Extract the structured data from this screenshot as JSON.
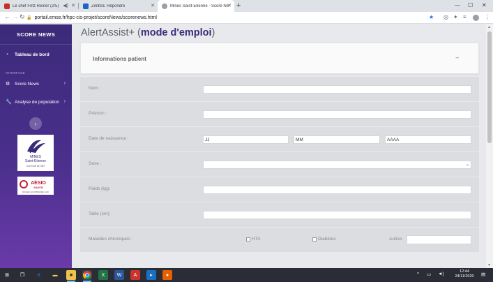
{
  "browser": {
    "tabs": [
      {
        "title": "Le chef Fritz Reiner (2/5)",
        "favicon_color": "#c4302b",
        "audio": true,
        "active": false
      },
      {
        "title": "Zimbra: Répondre",
        "favicon_color": "#1e64c8",
        "audio": false,
        "active": false
      },
      {
        "title": "Mines Saint-Etienne - Score News",
        "favicon_color": "#9aa0a6",
        "audio": false,
        "active": true
      }
    ],
    "new_tab_icon": "+",
    "url": "portail.emse.fr/hpc-cis-projet/scoreNews/scorenews.html",
    "window_controls": [
      "minimize-icon",
      "maximize-icon",
      "close-icon"
    ]
  },
  "sidebar": {
    "brand": "SCORE NEWS",
    "dashboard": "Tableau de bord",
    "section_label": "INTERFACE",
    "items": [
      {
        "label": "Score News",
        "icon": "gear-icon"
      },
      {
        "label": "Analyse de population",
        "icon": "wrench-icon"
      }
    ],
    "logos": {
      "mines": {
        "line1": "MINES",
        "line2": "Saint-Etienne",
        "tagline": "Une école de l'IMT"
      },
      "aesio": {
        "name": "AÉSIO",
        "sub": "SANTÉ",
        "tagline": "BOUGER, ACCOMPAGNER, AGIR"
      }
    }
  },
  "main": {
    "title_prefix": "AlertAssist+ (",
    "title_link": "mode d'emploi",
    "title_suffix": ")",
    "card_title": "Informations patient",
    "card_toggle": "–",
    "fields": {
      "nom": {
        "label": "Nom :",
        "value": ""
      },
      "prenom": {
        "label": "Prénom :",
        "value": ""
      },
      "dob": {
        "label": "Date de naissance :",
        "dd": "JJ",
        "mm": "MM",
        "yyyy": "AAAA"
      },
      "sexe": {
        "label": "Sexe :",
        "value": ""
      },
      "poids": {
        "label": "Poids (kg):",
        "value": ""
      },
      "taille": {
        "label": "Taille (cm):",
        "value": ""
      },
      "maladies": {
        "label": "Maladies chroniques :",
        "hta": "HTA",
        "diabetes": "Diabètes",
        "autres": "Autres",
        "hta_checked": false,
        "diabetes_checked": false
      }
    }
  },
  "taskbar": {
    "time": "12:44",
    "date": "24/11/2020"
  },
  "colors": {
    "sidebar_top": "#3b2b7a",
    "sidebar_bottom": "#6a3aa8",
    "accent": "#3b2b7a",
    "form_row": "#dcdde0"
  }
}
